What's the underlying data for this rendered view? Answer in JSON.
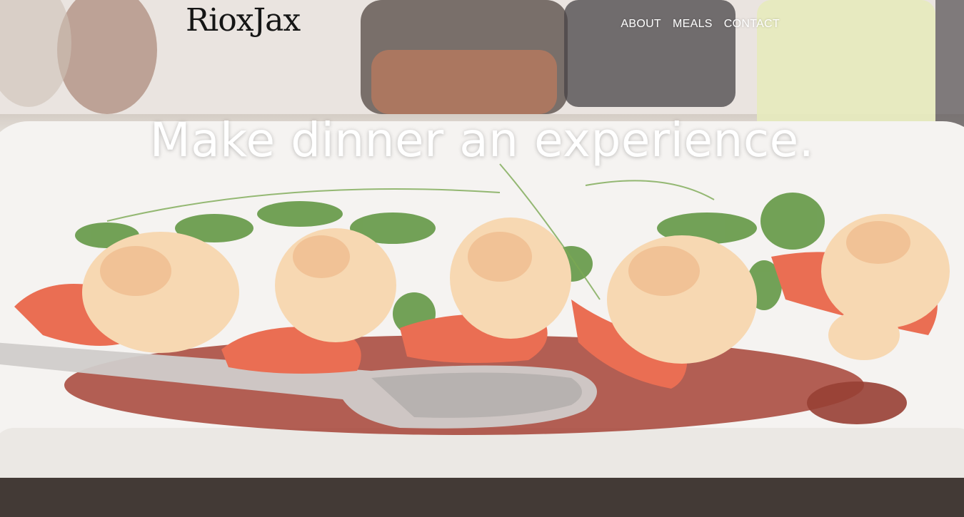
{
  "brand": {
    "logo_text": "RioxJax"
  },
  "nav": {
    "items": [
      {
        "label": "ABOUT"
      },
      {
        "label": "MEALS"
      },
      {
        "label": "CONTACT"
      }
    ]
  },
  "hero": {
    "headline": "Make dinner an experience.",
    "image_subject": "shrimp-with-cilantro-on-white-plate",
    "colors": {
      "text": "#ffffff",
      "logo": "#151515",
      "shrimp": "#e85a3c",
      "herb": "#4f8a2c",
      "plate": "#f4f2ef",
      "sauce": "#9a2a1c"
    }
  }
}
